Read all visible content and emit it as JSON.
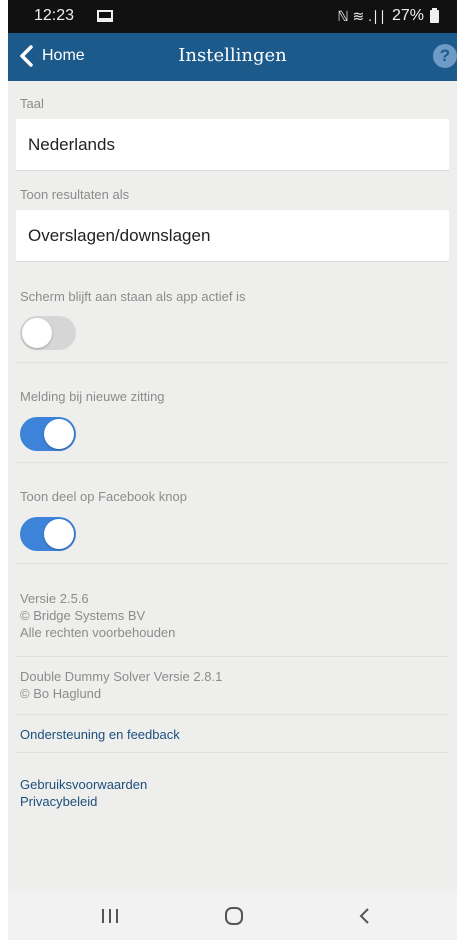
{
  "status_bar": {
    "time": "12:23",
    "signal_text": "ℕ ≋ .∣∣",
    "battery": "27%"
  },
  "header": {
    "back_label": "Home",
    "title": "Instellingen",
    "help_glyph": "?"
  },
  "settings": {
    "language_label": "Taal",
    "language_value": "Nederlands",
    "results_label": "Toon resultaten als",
    "results_value": "Overslagen/downslagen",
    "toggles": [
      {
        "label": "Scherm blijft aan staan als app actief is",
        "on": false
      },
      {
        "label": "Melding bij nieuwe zitting",
        "on": true
      },
      {
        "label": "Toon deel op Facebook knop",
        "on": true
      }
    ]
  },
  "about": {
    "version": "Versie 2.5.6",
    "copyright": "© Bridge Systems BV",
    "rights": "Alle rechten voorbehouden",
    "dds_version": "Double Dummy Solver Versie 2.8.1",
    "dds_copyright": "© Bo Haglund"
  },
  "links": {
    "support": "Ondersteuning en feedback",
    "terms": "Gebruiksvoorwaarden",
    "privacy": "Privacybeleid"
  },
  "colors": {
    "header": "#1d5a8c",
    "toggle_on": "#3d83d9",
    "toggle_off": "#d6d6d6",
    "link": "#1d4f7c"
  }
}
